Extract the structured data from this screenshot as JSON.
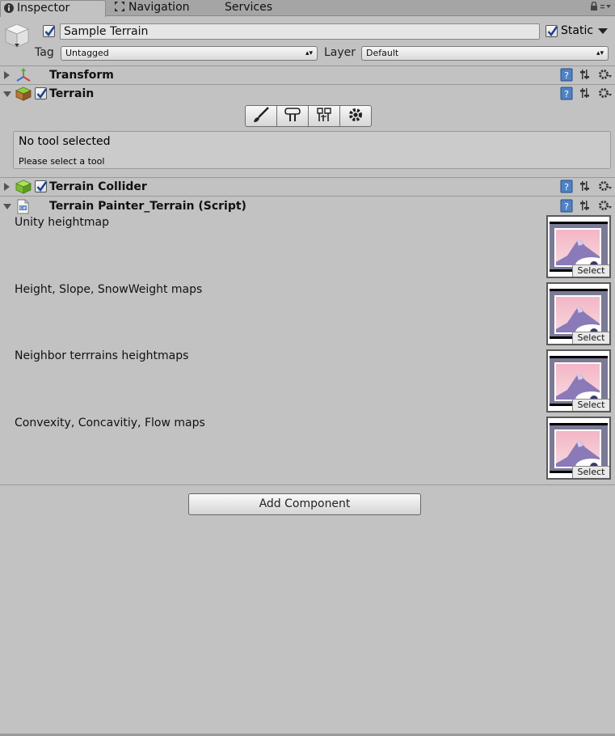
{
  "tabs": [
    {
      "label": "Inspector",
      "icon": "info-icon",
      "active": true
    },
    {
      "label": "Navigation",
      "icon": "navigation-icon",
      "active": false
    },
    {
      "label": "Services",
      "icon": "",
      "active": false
    }
  ],
  "game_object": {
    "active": true,
    "name": "Sample Terrain",
    "static_label": "Static",
    "static_checked": true,
    "tag_label": "Tag",
    "tag_value": "Untagged",
    "layer_label": "Layer",
    "layer_value": "Default"
  },
  "components": [
    {
      "title": "Transform",
      "expanded": false,
      "has_checkbox": false,
      "icon": "transform-icon"
    },
    {
      "title": "Terrain",
      "expanded": true,
      "has_checkbox": true,
      "icon": "terrain-icon"
    },
    {
      "title": "Terrain Collider",
      "expanded": false,
      "has_checkbox": true,
      "icon": "terrain-collider-icon"
    },
    {
      "title": "Terrain Painter_Terrain (Script)",
      "expanded": true,
      "has_checkbox": false,
      "icon": "script-icon"
    }
  ],
  "terrain_tools": {
    "buttons": [
      "paint-brush-icon",
      "place-trees-icon",
      "paint-details-icon",
      "terrain-settings-icon"
    ],
    "help_title": "No tool selected",
    "help_text": "Please select a tool"
  },
  "script_fields": [
    {
      "label": "Unity heightmap",
      "button": "Select"
    },
    {
      "label": "Height, Slope, SnowWeight maps",
      "button": "Select"
    },
    {
      "label": "Neighbor terrrains heightmaps",
      "button": "Select"
    },
    {
      "label": "Convexity, Concavitiy, Flow maps",
      "button": "Select"
    }
  ],
  "add_component_label": "Add Component",
  "colors": {
    "panel_bg": "#c2c2c2",
    "tabbar_bg": "#a5a5a5",
    "help_icon_blue": "#4f82c4",
    "terrain_green": "#6fb02e"
  }
}
